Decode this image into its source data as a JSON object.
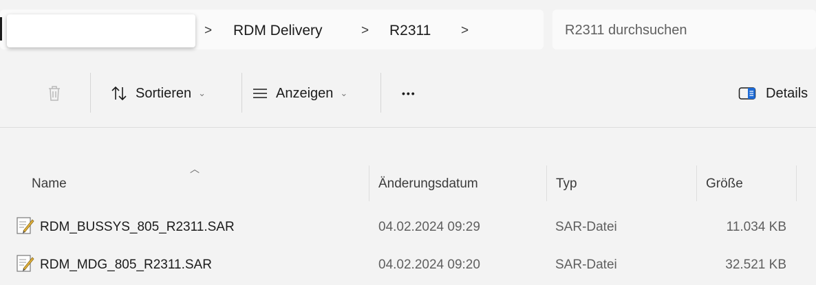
{
  "address": {
    "crumbs": [
      "RDM Delivery",
      "R2311"
    ],
    "separator": ">"
  },
  "search": {
    "placeholder": "R2311 durchsuchen"
  },
  "toolbar": {
    "sort_label": "Sortieren",
    "view_label": "Anzeigen",
    "more_label": "•••",
    "details_label": "Details"
  },
  "columns": {
    "name": "Name",
    "date": "Änderungsdatum",
    "type": "Typ",
    "size": "Größe"
  },
  "files": [
    {
      "name": "RDM_BUSSYS_805_R2311.SAR",
      "date": "04.02.2024 09:29",
      "type": "SAR-Datei",
      "size": "11.034 KB"
    },
    {
      "name": "RDM_MDG_805_R2311.SAR",
      "date": "04.02.2024 09:20",
      "type": "SAR-Datei",
      "size": "32.521 KB"
    }
  ]
}
